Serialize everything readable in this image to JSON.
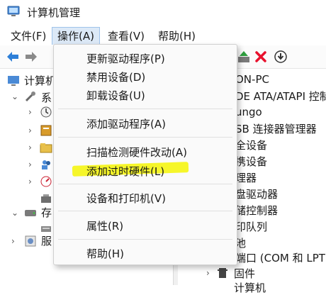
{
  "window": {
    "title": "计算机管理"
  },
  "menubar": {
    "file": "文件(F)",
    "action": "操作(A)",
    "view": "查看(V)",
    "help": "帮助(H)"
  },
  "tree": {
    "root_label": "计算机",
    "system_label": "系",
    "storage_label": "存",
    "services_label": "服"
  },
  "right": {
    "items": [
      "ON-PC",
      "DE ATA/ATAPI 控制",
      "ungo",
      "SB 连接器管理器",
      "全设备",
      "携设备",
      "理器",
      "盘驱动器",
      "储控制器",
      "印队列",
      "池",
      "端口 (COM 和 LPT)",
      "固件",
      "计算机"
    ]
  },
  "dropdown": {
    "items": [
      "更新驱动程序(P)",
      "禁用设备(D)",
      "卸载设备(U)",
      "添加驱动程序(A)",
      "扫描检测硬件改动(A)",
      "添加过时硬件(L)",
      "设备和打印机(V)",
      "属性(R)",
      "帮助(H)"
    ]
  },
  "colors": {
    "accent": "#1e6fd6",
    "highlight": "#f5f51f",
    "delete": "#e8112d",
    "add": "#2e9e3e"
  }
}
